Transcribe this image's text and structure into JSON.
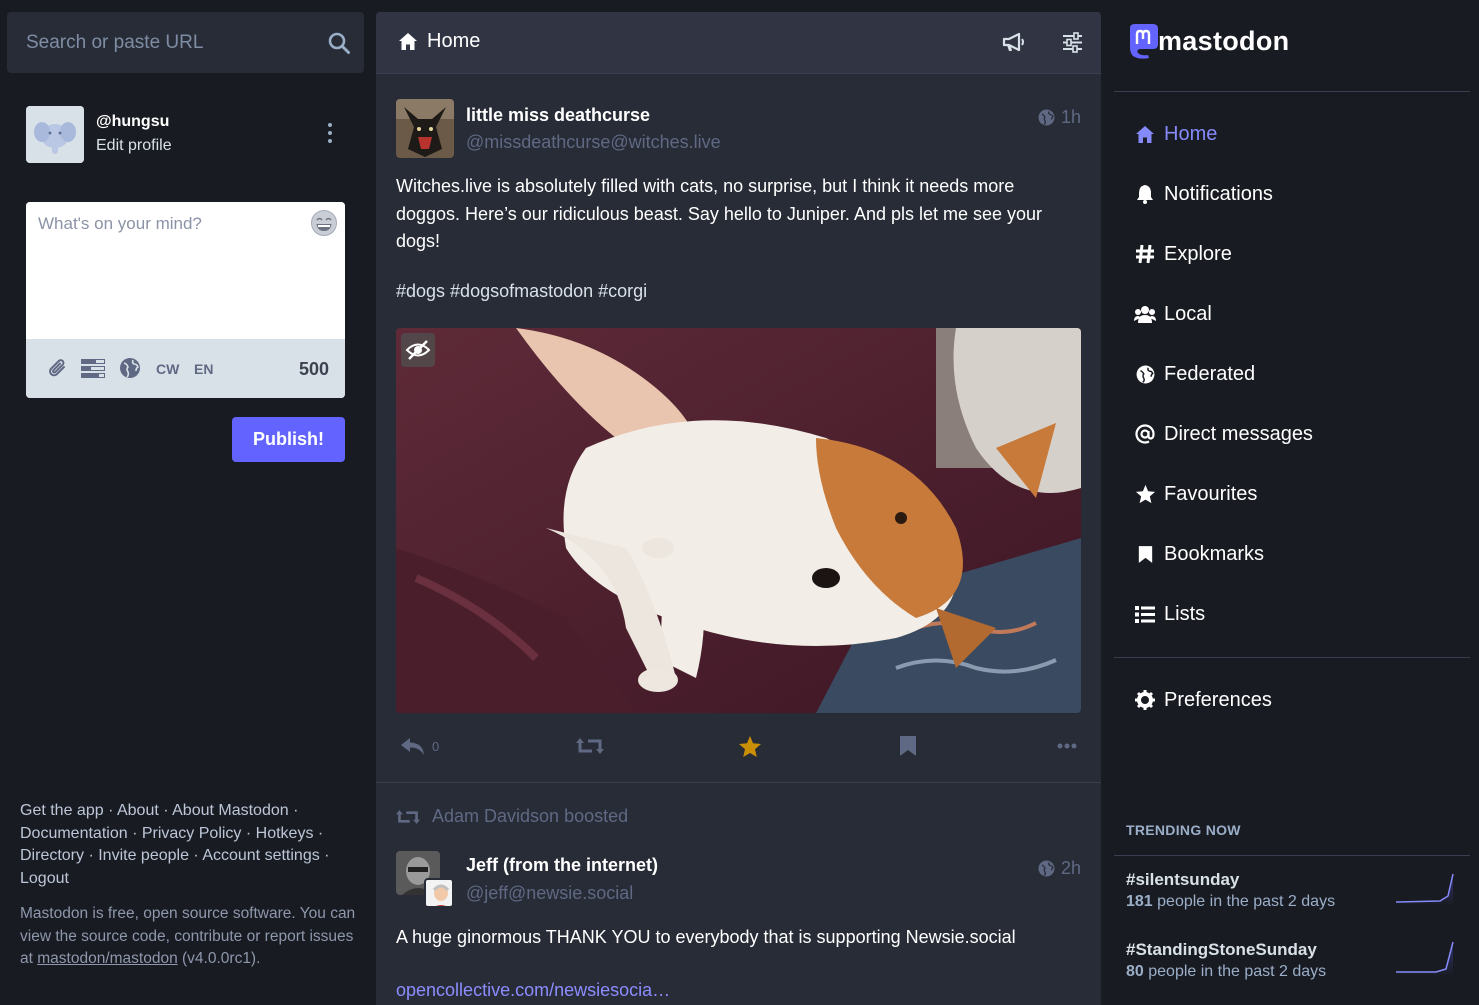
{
  "search": {
    "placeholder": "Search or paste URL"
  },
  "account": {
    "handle": "@hungsu",
    "edit_label": "Edit profile"
  },
  "compose": {
    "placeholder": "What's on your mind?",
    "cw_label": "CW",
    "lang_label": "EN",
    "char_count": "500",
    "publish_label": "Publish!"
  },
  "footer": {
    "links": [
      "Get the app",
      "About",
      "About Mastodon",
      "Documentation",
      "Privacy Policy",
      "Hotkeys",
      "Directory",
      "Invite people",
      "Account settings",
      "Logout"
    ],
    "about_text": "Mastodon is free, open source software. You can view the source code, contribute or report issues at",
    "repo_link": "mastodon/mastodon",
    "version": "(v4.0.0rc1)."
  },
  "column": {
    "title": "Home"
  },
  "statuses": [
    {
      "display_name": "little miss deathcurse",
      "handle": "@missdeathcurse@witches.live",
      "time": "1h",
      "content": "Witches.live is absolutely filled with cats, no surprise, but I think it needs more doggos. Here’s our ridiculous beast. Say hello to Juniper. And pls let me see your dogs!",
      "hashtags": "#dogs #dogsofmastodon #corgi",
      "reply_count": "0"
    },
    {
      "boosted_by": "Adam Davidson boosted",
      "display_name": "Jeff (from the internet)",
      "handle": "@jeff@newsie.social",
      "time": "2h",
      "content": "A huge ginormous THANK YOU to everybody that is supporting Newsie.social",
      "link": "opencollective.com/newsiesocia…"
    }
  ],
  "brand": {
    "name": "mastodon",
    "accent": "#6364ff"
  },
  "nav": {
    "items": [
      {
        "label": "Home",
        "icon": "home-icon"
      },
      {
        "label": "Notifications",
        "icon": "bell-icon"
      },
      {
        "label": "Explore",
        "icon": "hashtag-icon"
      },
      {
        "label": "Local",
        "icon": "users-icon"
      },
      {
        "label": "Federated",
        "icon": "globe-icon"
      },
      {
        "label": "Direct messages",
        "icon": "at-icon"
      },
      {
        "label": "Favourites",
        "icon": "star-icon"
      },
      {
        "label": "Bookmarks",
        "icon": "bookmark-icon"
      },
      {
        "label": "Lists",
        "icon": "list-icon"
      }
    ],
    "preferences": "Preferences"
  },
  "trending": {
    "title": "TRENDING NOW",
    "items": [
      {
        "tag": "#silentsunday",
        "count": "181",
        "meta": "people in the past 2 days"
      },
      {
        "tag": "#StandingStoneSunday",
        "count": "80",
        "meta": "people in the past 2 days"
      }
    ]
  }
}
